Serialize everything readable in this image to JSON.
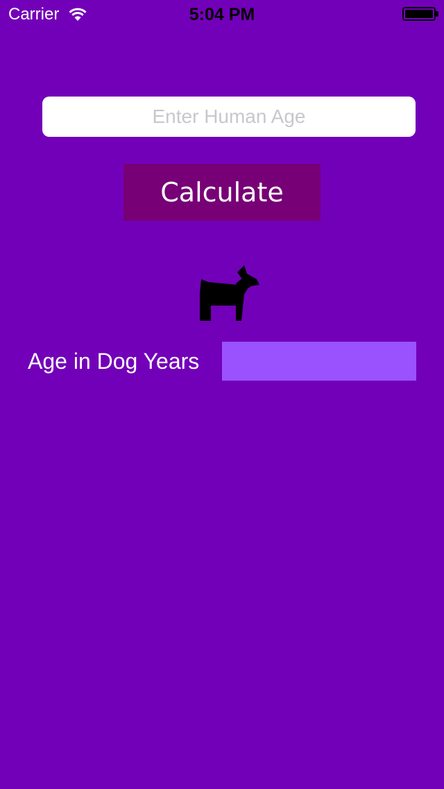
{
  "status_bar": {
    "carrier": "Carrier",
    "time": "5:04 PM",
    "wifi_icon": "wifi-icon",
    "battery_icon": "battery-icon"
  },
  "form": {
    "age_input": {
      "value": "",
      "placeholder": "Enter Human Age"
    },
    "calculate_label": "Calculate"
  },
  "result": {
    "icon": "dog-icon",
    "label": "Age in Dog Years",
    "value": ""
  },
  "colors": {
    "background": "#7300b9",
    "button": "#770076",
    "result_field": "#9a52ff",
    "input": "#ffffff"
  }
}
